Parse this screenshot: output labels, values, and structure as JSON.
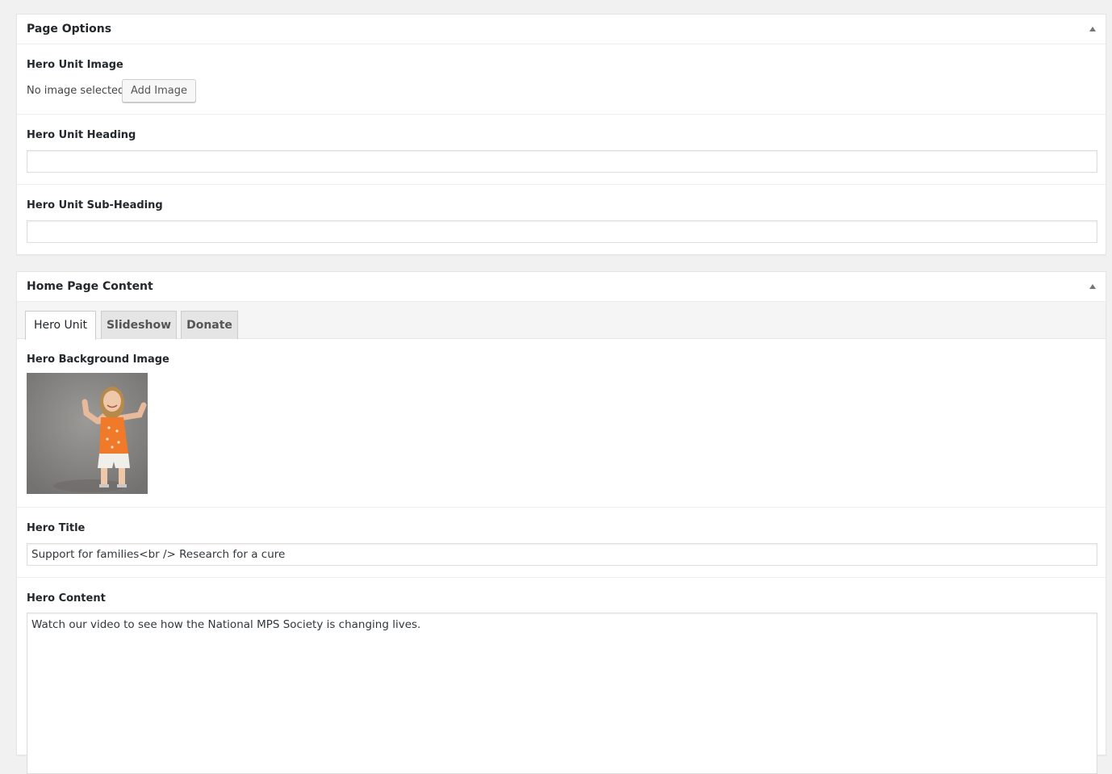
{
  "page_options": {
    "title": "Page Options",
    "hero_unit_image": {
      "label": "Hero Unit Image",
      "status": "No image selected",
      "button": "Add Image"
    },
    "hero_unit_heading": {
      "label": "Hero Unit Heading",
      "value": ""
    },
    "hero_unit_subheading": {
      "label": "Hero Unit Sub-Heading",
      "value": ""
    }
  },
  "home_page_content": {
    "title": "Home Page Content",
    "tabs": [
      {
        "label": "Hero Unit",
        "active": true
      },
      {
        "label": "Slideshow",
        "active": false
      },
      {
        "label": "Donate",
        "active": false
      }
    ],
    "hero_background_image": {
      "label": "Hero Background Image",
      "icon": "photo-thumbnail"
    },
    "hero_title": {
      "label": "Hero Title",
      "value": "Support for families<br /> Research for a cure"
    },
    "hero_content": {
      "label": "Hero Content",
      "value": "Watch our video to see how the National MPS Society is changing lives."
    }
  },
  "colors": {
    "background": "#f1f1f1",
    "panel": "#ffffff",
    "border": "#e5e5e5",
    "text": "#23282d",
    "shirt_orange": "#f07a2a"
  }
}
